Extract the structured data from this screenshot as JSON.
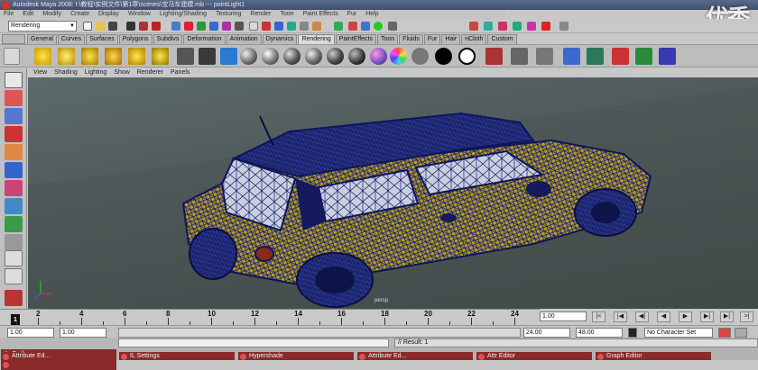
{
  "window": {
    "title": "Autodesk Maya 2008: I:\\教程\\实例文件\\第1章\\scenes\\宝马车建模.mb --- pointLight1",
    "watermark": "优秀"
  },
  "menubar": [
    "File",
    "Edit",
    "Modify",
    "Create",
    "Display",
    "Window",
    "Lighting/Shading",
    "Texturing",
    "Render",
    "Toon",
    "Paint Effects",
    "Fur",
    "Help"
  ],
  "status_line": {
    "mode": "Rendering"
  },
  "shelf_tabs": [
    {
      "label": "General",
      "active": false
    },
    {
      "label": "Curves",
      "active": false
    },
    {
      "label": "Surfaces",
      "active": false
    },
    {
      "label": "Polygons",
      "active": false
    },
    {
      "label": "Subdivs",
      "active": false
    },
    {
      "label": "Deformation",
      "active": false
    },
    {
      "label": "Animation",
      "active": false
    },
    {
      "label": "Dynamics",
      "active": false
    },
    {
      "label": "Rendering",
      "active": true
    },
    {
      "label": "PaintEffects",
      "active": false
    },
    {
      "label": "Toon",
      "active": false
    },
    {
      "label": "Fluids",
      "active": false
    },
    {
      "label": "Fur",
      "active": false
    },
    {
      "label": "Hair",
      "active": false
    },
    {
      "label": "nCloth",
      "active": false
    },
    {
      "label": "Custom",
      "active": false
    }
  ],
  "panel_menu": [
    "View",
    "Shading",
    "Lighting",
    "Show",
    "Renderer",
    "Panels"
  ],
  "viewport": {
    "camera_label": "persp"
  },
  "timeline": {
    "tick_labels": [
      "2",
      "4",
      "6",
      "8",
      "10",
      "12",
      "14",
      "16",
      "18",
      "20",
      "22",
      "24"
    ],
    "current_time": "1.00",
    "current_frame_label": "1",
    "playback_buttons": [
      "|<",
      "|◀",
      "◀|",
      "◀",
      "▶",
      "▶|",
      "▶|",
      ">|"
    ]
  },
  "range": {
    "start_time": "1.00",
    "playback_start": "1.00",
    "playback_end": "24.00",
    "end_time": "48.00",
    "character_set": "No Character Set"
  },
  "command_line": {
    "result": "// Result: 1"
  },
  "taskbar": [
    "Outliner",
    "Attribute Ed...",
    "IL Settings",
    "Hypershade",
    "Attribute Ed...",
    "Attr Editor",
    "Graph Editor"
  ],
  "colors": {
    "car_body": "#b8a01a",
    "wireframe": "#1a1f7a",
    "viewport_bg": "#56615f"
  }
}
